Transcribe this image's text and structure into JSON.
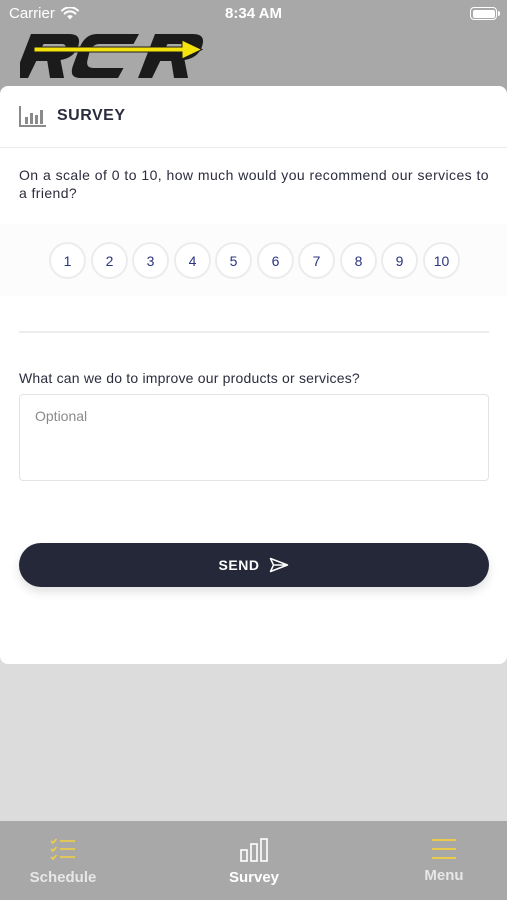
{
  "status_bar": {
    "carrier": "Carrier",
    "time": "8:34 AM"
  },
  "brand": {
    "logo_text": "RCR",
    "accent_color": "#f4e20c",
    "dark_color": "#1b1b1b"
  },
  "card": {
    "title": "SURVEY",
    "title_icon": "bar-chart-icon"
  },
  "question1": {
    "text": "On a scale of 0 to 10, how much would you recommend our services to a friend?"
  },
  "scale": {
    "options": [
      "1",
      "2",
      "3",
      "4",
      "5",
      "6",
      "7",
      "8",
      "9",
      "10"
    ],
    "number_color": "#2c3480"
  },
  "question2": {
    "text": "What can we do to improve our products or services?",
    "placeholder": "Optional",
    "value": ""
  },
  "send": {
    "label": "SEND",
    "icon": "paper-plane-icon",
    "color": "#252838"
  },
  "tabs": [
    {
      "label": "Schedule",
      "icon": "checklist-icon",
      "active": false,
      "icon_color": "#f4d03f"
    },
    {
      "label": "Survey",
      "icon": "bar-chart-icon",
      "active": true,
      "icon_color": "#ffffff"
    },
    {
      "label": "Menu",
      "icon": "hamburger-menu-icon",
      "active": false,
      "icon_color": "#f4d03f"
    }
  ]
}
